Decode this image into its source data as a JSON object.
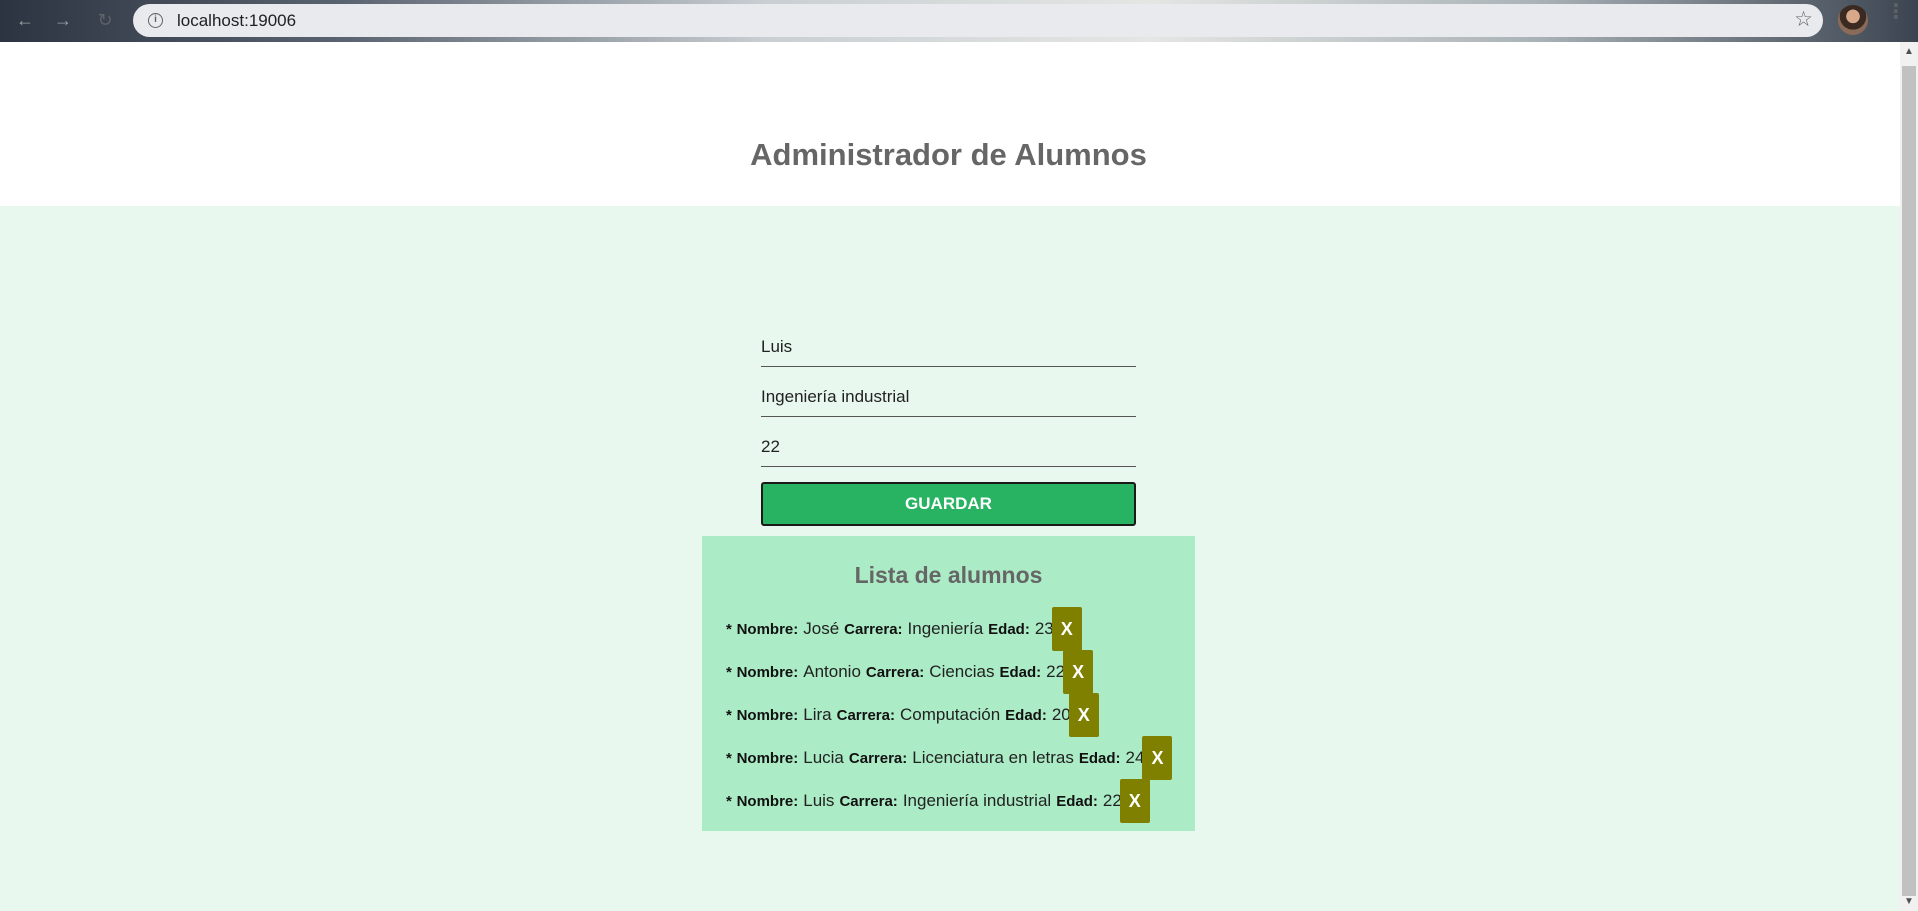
{
  "browser": {
    "url": "localhost:19006",
    "back_icon": "arrow-left-icon",
    "forward_icon": "arrow-right-icon",
    "reload_icon": "reload-icon",
    "star_icon": "star-icon",
    "menu_icon": "kebab-menu-icon"
  },
  "page": {
    "title": "Administrador de Alumnos"
  },
  "form": {
    "name_value": "Luis",
    "career_value": "Ingeniería industrial",
    "age_value": "22",
    "save_label": "GUARDAR"
  },
  "list": {
    "title": "Lista de alumnos",
    "bullet": "*",
    "name_label": "Nombre:",
    "career_label": "Carrera:",
    "age_label": "Edad:",
    "delete_label": "X",
    "students": [
      {
        "name": "José",
        "career": "Ingeniería",
        "age": "23"
      },
      {
        "name": "Antonio",
        "career": "Ciencias",
        "age": "22"
      },
      {
        "name": "Lira",
        "career": "Computación",
        "age": "20"
      },
      {
        "name": "Lucia",
        "career": "Licenciatura en letras",
        "age": "24"
      },
      {
        "name": "Luis",
        "career": "Ingeniería industrial",
        "age": "22"
      }
    ]
  },
  "colors": {
    "header_bg": "#ffffff",
    "main_bg": "#e8f8ef",
    "list_bg": "#abebc6",
    "save_button": "#27b362",
    "delete_button": "#808000",
    "title_text": "#666666"
  }
}
